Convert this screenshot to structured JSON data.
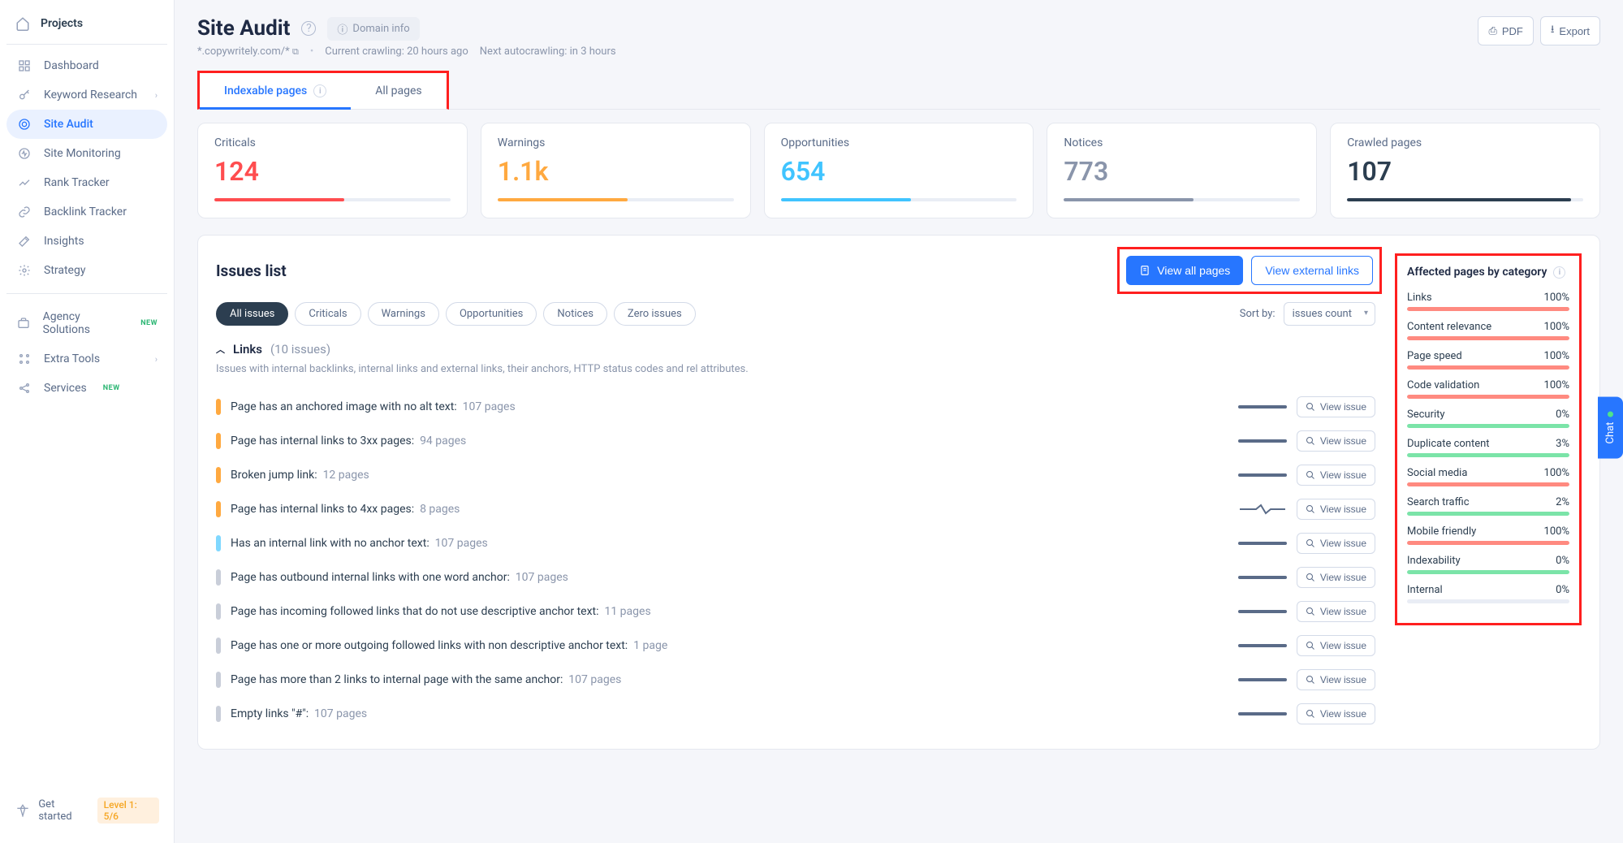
{
  "sidebar": {
    "top": "Projects",
    "nav": [
      {
        "label": "Dashboard",
        "icon": "grid"
      },
      {
        "label": "Keyword Research",
        "icon": "key",
        "chev": true
      },
      {
        "label": "Site Audit",
        "icon": "target",
        "active": true
      },
      {
        "label": "Site Monitoring",
        "icon": "pulse"
      },
      {
        "label": "Rank Tracker",
        "icon": "trend"
      },
      {
        "label": "Backlink Tracker",
        "icon": "link"
      },
      {
        "label": "Insights",
        "icon": "wand"
      },
      {
        "label": "Strategy",
        "icon": "gear"
      }
    ],
    "nav2": [
      {
        "label": "Agency Solutions",
        "icon": "briefcase",
        "new": true
      },
      {
        "label": "Extra Tools",
        "icon": "modules",
        "chev": true
      },
      {
        "label": "Services",
        "icon": "share",
        "new": true
      }
    ],
    "bottom": {
      "label": "Get started",
      "level": "Level 1: 5/6"
    }
  },
  "header": {
    "title": "Site Audit",
    "domain_info": "Domain info",
    "domain": "*.copywritely.com/*",
    "crawl_current": "Current crawling: 20 hours ago",
    "crawl_next": "Next autocrawling: in 3 hours",
    "pdf": "PDF",
    "export": "Export"
  },
  "tabs": [
    {
      "label": "Indexable pages",
      "active": true,
      "info": true
    },
    {
      "label": "All pages"
    }
  ],
  "stats": [
    {
      "label": "Criticals",
      "value": "124",
      "color": "#ff4d4f",
      "fill": 55
    },
    {
      "label": "Warnings",
      "value": "1.1k",
      "color": "#ffa940",
      "fill": 55
    },
    {
      "label": "Opportunities",
      "value": "654",
      "color": "#40c4ff",
      "fill": 55
    },
    {
      "label": "Notices",
      "value": "773",
      "color": "#8a95ab",
      "fill": 55
    },
    {
      "label": "Crawled pages",
      "value": "107",
      "color": "#2c3e50",
      "fill": 95
    }
  ],
  "issues": {
    "title": "Issues list",
    "view_all": "View all pages",
    "view_ext": "View external links",
    "filters": [
      "All issues",
      "Criticals",
      "Warnings",
      "Opportunities",
      "Notices",
      "Zero issues"
    ],
    "sort_label": "Sort by:",
    "sort_value": "issues count",
    "group": {
      "name": "Links",
      "count": "(10 issues)",
      "desc": "Issues with internal backlinks, internal links and external links, their anchors, HTTP status codes and rel attributes."
    },
    "rows": [
      {
        "sev": "#ffa940",
        "text": "Page has an anchored image with no alt text:",
        "count": "107 pages"
      },
      {
        "sev": "#ffa940",
        "text": "Page has internal links to 3xx pages:",
        "count": "94 pages"
      },
      {
        "sev": "#ffa940",
        "text": "Broken jump link:",
        "count": "12 pages"
      },
      {
        "sev": "#ffa940",
        "text": "Page has internal links to 4xx pages:",
        "count": "8 pages"
      },
      {
        "sev": "#80d8ff",
        "text": "Has an internal link with no anchor text:",
        "count": "107 pages"
      },
      {
        "sev": "#c9ced9",
        "text": "Page has outbound internal links with one word anchor:",
        "count": "107 pages"
      },
      {
        "sev": "#c9ced9",
        "text": "Page has incoming followed links that do not use descriptive anchor text:",
        "count": "11 pages"
      },
      {
        "sev": "#c9ced9",
        "text": "Page has one or more outgoing followed links with non descriptive anchor text:",
        "count": "1 page"
      },
      {
        "sev": "#c9ced9",
        "text": "Page has more than 2 links to internal page with the same anchor:",
        "count": "107 pages"
      },
      {
        "sev": "#c9ced9",
        "text": "Empty links \"#\":",
        "count": "107 pages"
      }
    ],
    "view_issue": "View issue"
  },
  "categories": {
    "title": "Affected pages by category",
    "rows": [
      {
        "name": "Links",
        "pct": "100%",
        "fill": 100,
        "color": "#ff8a80"
      },
      {
        "name": "Content relevance",
        "pct": "100%",
        "fill": 100,
        "color": "#ff8a80"
      },
      {
        "name": "Page speed",
        "pct": "100%",
        "fill": 100,
        "color": "#ff8a80"
      },
      {
        "name": "Code validation",
        "pct": "100%",
        "fill": 100,
        "color": "#ff8a80"
      },
      {
        "name": "Security",
        "pct": "0%",
        "fill": 100,
        "color": "#7be4a8"
      },
      {
        "name": "Duplicate content",
        "pct": "3%",
        "fill": 100,
        "color": "#7be4a8"
      },
      {
        "name": "Social media",
        "pct": "100%",
        "fill": 100,
        "color": "#ff8a80"
      },
      {
        "name": "Search traffic",
        "pct": "2%",
        "fill": 100,
        "color": "#7be4a8"
      },
      {
        "name": "Mobile friendly",
        "pct": "100%",
        "fill": 100,
        "color": "#ff8a80"
      },
      {
        "name": "Indexability",
        "pct": "0%",
        "fill": 100,
        "color": "#7be4a8"
      },
      {
        "name": "Internal",
        "pct": "0%",
        "fill": 0,
        "color": "#7be4a8"
      }
    ]
  },
  "chat": "Chat"
}
